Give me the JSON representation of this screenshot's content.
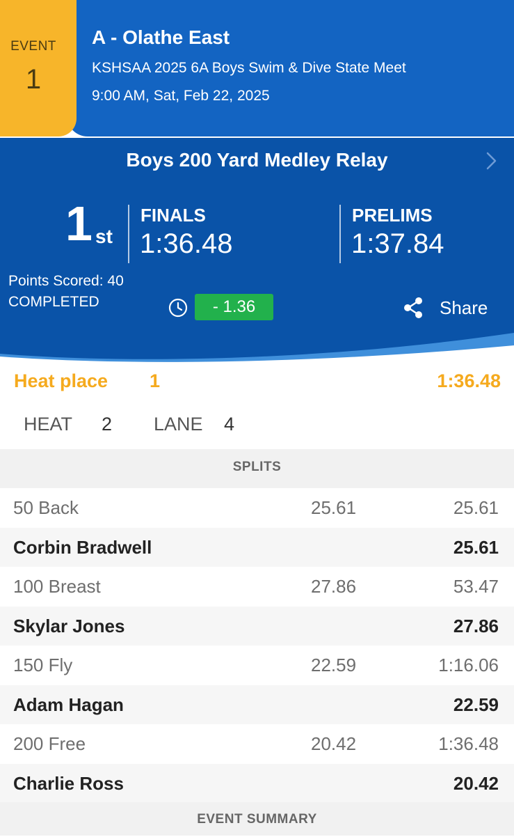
{
  "header": {
    "event_label": "EVENT",
    "event_number": "1",
    "team_name": "A - Olathe East",
    "meet_name": "KSHSAA 2025 6A Boys Swim & Dive State Meet",
    "datetime": "9:00 AM, Sat, Feb 22, 2025"
  },
  "result": {
    "event_title": "Boys 200 Yard Medley Relay",
    "place": "1",
    "place_suffix": "st",
    "finals_label": "FINALS",
    "finals_time": "1:36.48",
    "prelims_label": "PRELIMS",
    "prelims_time": "1:37.84",
    "points": "Points Scored: 40",
    "status": "COMPLETED",
    "time_diff": "- 1.36",
    "share_label": "Share"
  },
  "heat": {
    "place_label": "Heat place",
    "place_value": "1",
    "time": "1:36.48",
    "heat_label": "HEAT",
    "heat_value": "2",
    "lane_label": "LANE",
    "lane_value": "4"
  },
  "splits": {
    "header": "SPLITS",
    "rows": [
      {
        "type": "split",
        "name": "50 Back",
        "split": "25.61",
        "cumulative": "25.61"
      },
      {
        "type": "swimmer",
        "name": "Corbin Bradwell",
        "split": "",
        "cumulative": "25.61"
      },
      {
        "type": "split",
        "name": "100 Breast",
        "split": "27.86",
        "cumulative": "53.47"
      },
      {
        "type": "swimmer",
        "name": "Skylar Jones",
        "split": "",
        "cumulative": "27.86"
      },
      {
        "type": "split",
        "name": "150 Fly",
        "split": "22.59",
        "cumulative": "1:16.06"
      },
      {
        "type": "swimmer",
        "name": "Adam Hagan",
        "split": "",
        "cumulative": "22.59"
      },
      {
        "type": "split",
        "name": "200 Free",
        "split": "20.42",
        "cumulative": "1:36.48"
      },
      {
        "type": "swimmer",
        "name": "Charlie Ross",
        "split": "",
        "cumulative": "20.42"
      }
    ]
  },
  "summary": {
    "header": "EVENT SUMMARY"
  },
  "colors": {
    "header_blue": "#1364c2",
    "panel_blue": "#0a53a8",
    "badge_yellow": "#f7b52a",
    "accent_orange": "#f5aa1e",
    "improvement_green": "#22b14c"
  },
  "icons": [
    "chevron-right-icon",
    "clock-icon",
    "share-icon"
  ]
}
